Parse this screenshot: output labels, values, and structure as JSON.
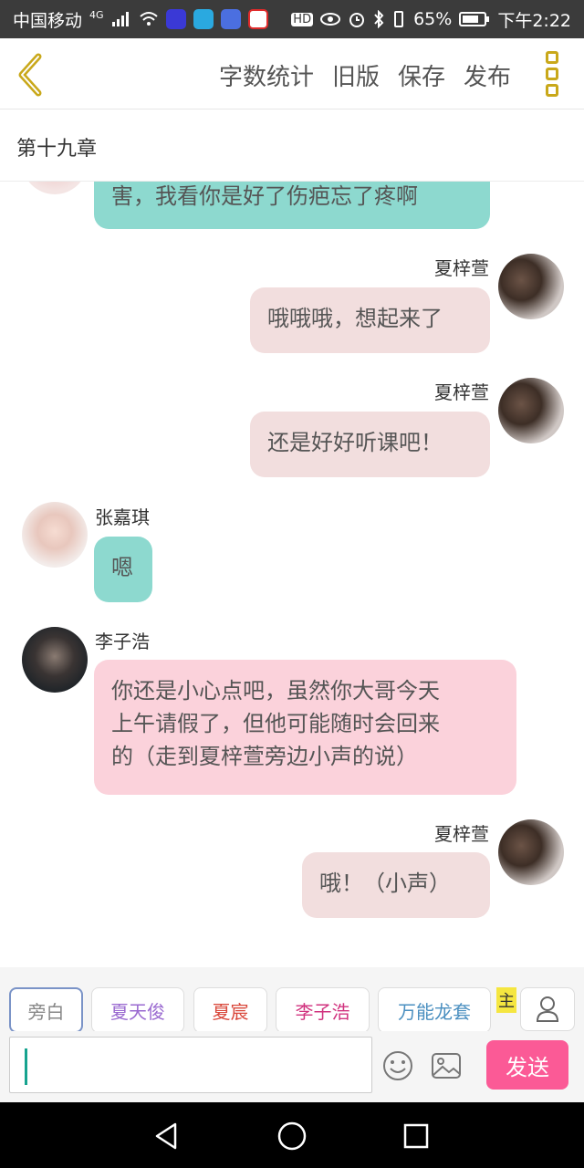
{
  "status_bar": {
    "carrier": "中国移动",
    "network": "4G",
    "battery": "65%",
    "time": "下午2:22",
    "hd": "HD"
  },
  "toolbar": {
    "actions": [
      "字数统计",
      "旧版",
      "保存",
      "发布"
    ],
    "accent": "#c9a81a"
  },
  "chapter": {
    "title": "第十九章"
  },
  "messages": [
    {
      "sender": "",
      "side": "left",
      "text": "害，我看你是好了伤疤忘了疼啊",
      "color": "#8dd9cf"
    },
    {
      "sender": "夏梓萱",
      "side": "right",
      "text": "哦哦哦，想起来了",
      "color": "#f2dede"
    },
    {
      "sender": "夏梓萱",
      "side": "right",
      "text": "还是好好听课吧！",
      "color": "#f2dede"
    },
    {
      "sender": "张嘉琪",
      "side": "left",
      "text": "嗯",
      "color": "#8dd9cf"
    },
    {
      "sender": "李子浩",
      "side": "left",
      "text_lines": [
        "你还是小心点吧，虽然你大哥今天",
        "上午请假了，但他可能随时会回来",
        "的（走到夏梓萱旁边小声的说）"
      ],
      "color": "#fbd2db"
    },
    {
      "sender": "夏梓萱",
      "side": "right",
      "text": "哦！（小声）",
      "color": "#f2dede"
    }
  ],
  "roles": [
    {
      "label": "旁白",
      "color": "#888888"
    },
    {
      "label": "夏天俊",
      "color": "#9a6ad0"
    },
    {
      "label": "夏宸",
      "color": "#d9473a"
    },
    {
      "label": "李子浩",
      "color": "#d1337f"
    },
    {
      "label": "万能龙套",
      "color": "#4a8fc0"
    }
  ],
  "role_extra": "主",
  "input": {
    "placeholder": "",
    "send_label": "发送",
    "send_color": "#fb5a96"
  }
}
